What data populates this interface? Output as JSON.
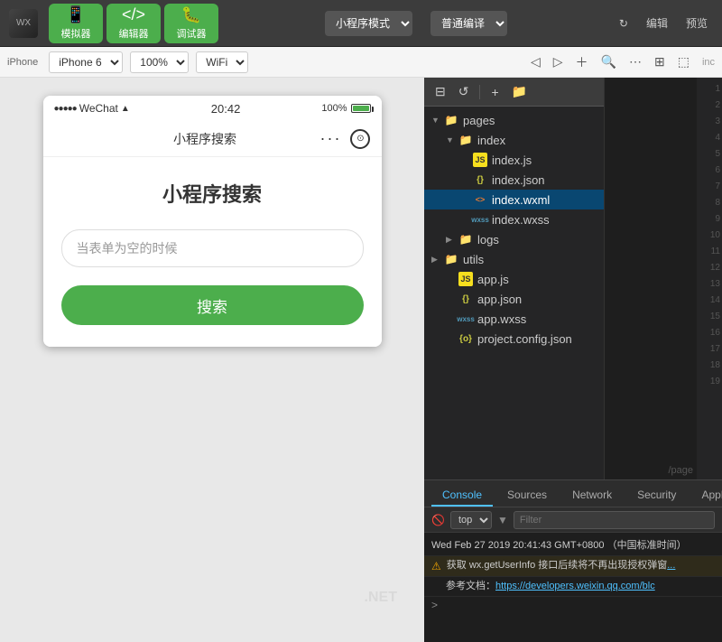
{
  "toolbar": {
    "simulator_label": "模拟器",
    "editor_label": "编辑器",
    "debugger_label": "调试器",
    "mode_label": "小程序模式",
    "compile_label": "普通编译",
    "edit_label": "编辑",
    "preview_label": "预览"
  },
  "second_toolbar": {
    "device": "iPhone 6",
    "zoom": "100%",
    "network": "WiFi"
  },
  "phone": {
    "status_bar": {
      "left": "●●●●●",
      "wechat": "WeChat",
      "wifi": "📶",
      "time": "20:42",
      "battery": "100%"
    },
    "nav": {
      "title": "小程序搜索"
    },
    "content": {
      "title": "小程序搜索",
      "input_placeholder": "当表单为空的时候",
      "search_btn": "搜索"
    }
  },
  "file_tree": {
    "items": [
      {
        "id": "pages-folder",
        "indent": 1,
        "type": "folder",
        "arrow": "open",
        "label": "pages"
      },
      {
        "id": "index-folder",
        "indent": 2,
        "type": "folder",
        "arrow": "open",
        "label": "index"
      },
      {
        "id": "index-js",
        "indent": 3,
        "type": "js",
        "arrow": "none",
        "label": "index.js"
      },
      {
        "id": "index-json",
        "indent": 3,
        "type": "json",
        "arrow": "none",
        "label": "index.json"
      },
      {
        "id": "index-wxml",
        "indent": 3,
        "type": "wxml",
        "arrow": "none",
        "label": "index.wxml",
        "selected": true
      },
      {
        "id": "index-wxss",
        "indent": 3,
        "type": "wxss",
        "arrow": "none",
        "label": "index.wxss"
      },
      {
        "id": "logs-folder",
        "indent": 2,
        "type": "folder",
        "arrow": "closed",
        "label": "logs"
      },
      {
        "id": "utils-folder",
        "indent": 1,
        "type": "folder",
        "arrow": "closed",
        "label": "utils"
      },
      {
        "id": "app-js",
        "indent": 2,
        "type": "js",
        "arrow": "none",
        "label": "app.js"
      },
      {
        "id": "app-json",
        "indent": 2,
        "type": "json",
        "arrow": "none",
        "label": "app.json"
      },
      {
        "id": "app-wxss",
        "indent": 2,
        "type": "wxss",
        "arrow": "none",
        "label": "app.wxss"
      },
      {
        "id": "project-config",
        "indent": 2,
        "type": "json-config",
        "arrow": "none",
        "label": "project.config.json"
      }
    ]
  },
  "console": {
    "tabs": [
      "Console",
      "Sources",
      "Network",
      "Security",
      "AppDa"
    ],
    "active_tab": "Console",
    "filter_level": "top",
    "filter_placeholder": "Filter",
    "entries": [
      {
        "type": "timestamp",
        "text": "Wed Feb 27 2019 20:41:43 GMT+0800 （中国标准时间）"
      },
      {
        "type": "warn",
        "text": "获取 wx.getUserInfo 接口后续将不再出现授权弹窗",
        "link": "https://developers.weixin.qq.com/blc"
      },
      {
        "type": "ref",
        "text": "参考文档：",
        "link": "https://developers.weixin.qq.com/blc"
      }
    ],
    "arrow": ">"
  },
  "watermark": ".NET"
}
